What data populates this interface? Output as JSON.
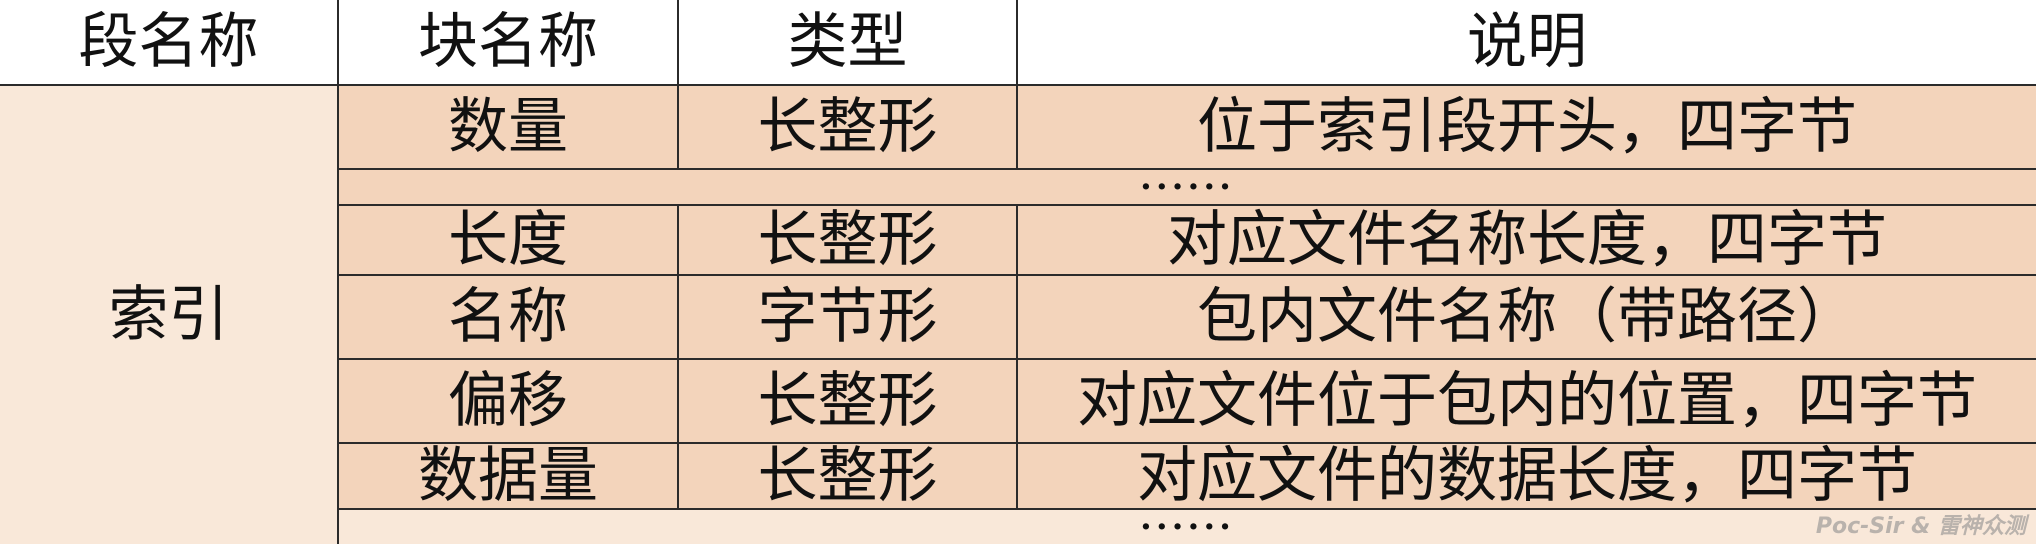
{
  "headers": [
    "段名称",
    "块名称",
    "类型",
    "说明"
  ],
  "segment": "索引",
  "rows": [
    {
      "name": "数量",
      "type": "长整形",
      "desc": "位于索引段开头，四字节"
    },
    {
      "name": "长度",
      "type": "长整形",
      "desc": "对应文件名称长度，四字节"
    },
    {
      "name": "名称",
      "type": "字节形",
      "desc": "包内文件名称（带路径）"
    },
    {
      "name": "偏移",
      "type": "长整形",
      "desc": "对应文件位于包内的位置，四字节"
    },
    {
      "name": "数据量",
      "type": "长整形",
      "desc": "对应文件的数据长度，四字节"
    }
  ],
  "ellipsis": "······",
  "watermark": "Poc-Sir & 雷神众测"
}
